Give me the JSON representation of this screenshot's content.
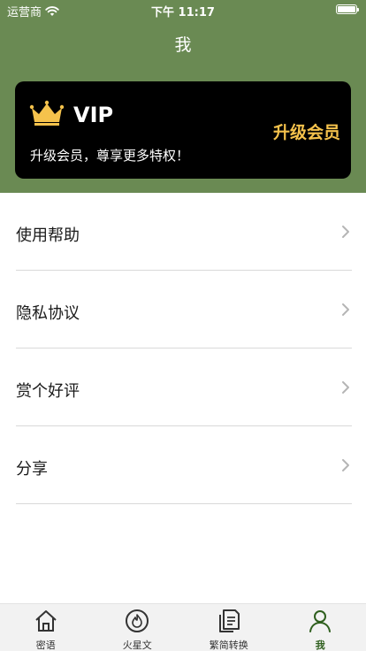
{
  "status_bar": {
    "carrier": "运营商",
    "time": "下午 11:17"
  },
  "nav": {
    "title": "我"
  },
  "vip_card": {
    "title": "VIP",
    "subtitle": "升级会员，尊享更多特权！",
    "upgrade_label": "升级会员"
  },
  "menu": {
    "items": [
      {
        "label": "使用帮助"
      },
      {
        "label": "隐私协议"
      },
      {
        "label": "赏个好评"
      },
      {
        "label": "分享"
      }
    ]
  },
  "tabbar": {
    "tabs": [
      {
        "label": "密语",
        "icon": "home-icon"
      },
      {
        "label": "火星文",
        "icon": "fire-icon"
      },
      {
        "label": "繁简转换",
        "icon": "document-icon"
      },
      {
        "label": "我",
        "icon": "user-icon"
      }
    ],
    "active_index": 3
  },
  "colors": {
    "header_bg": "#6a8a53",
    "vip_accent": "#f5c24c",
    "active_tab": "#2f5f1e"
  }
}
